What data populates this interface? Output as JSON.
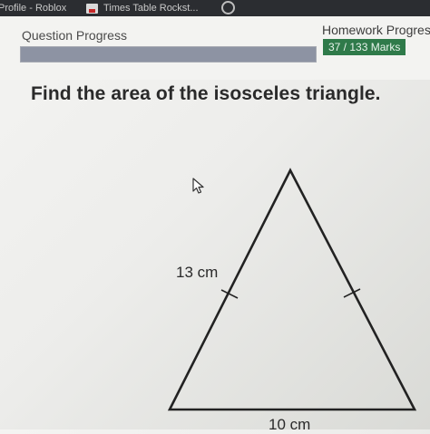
{
  "browser": {
    "tabs": [
      {
        "label": "Profile - Roblox"
      },
      {
        "label": "Times Table Rockst..."
      }
    ]
  },
  "header": {
    "question_progress_label": "Question Progress",
    "question_progress_fraction": 1.0,
    "homework_progress_label": "Homework Progres",
    "marks_badge": "37 / 133 Marks"
  },
  "question": {
    "text": "Find the area of the isosceles triangle."
  },
  "diagram": {
    "shape": "isosceles-triangle",
    "side_label": "13 cm",
    "base_label": "10 cm",
    "equal_sides_tick_marks": true
  },
  "colors": {
    "marks_badge": "#2f7a4a",
    "progress_track": "#b9bcc4",
    "browser_bar": "#2b2d31"
  }
}
